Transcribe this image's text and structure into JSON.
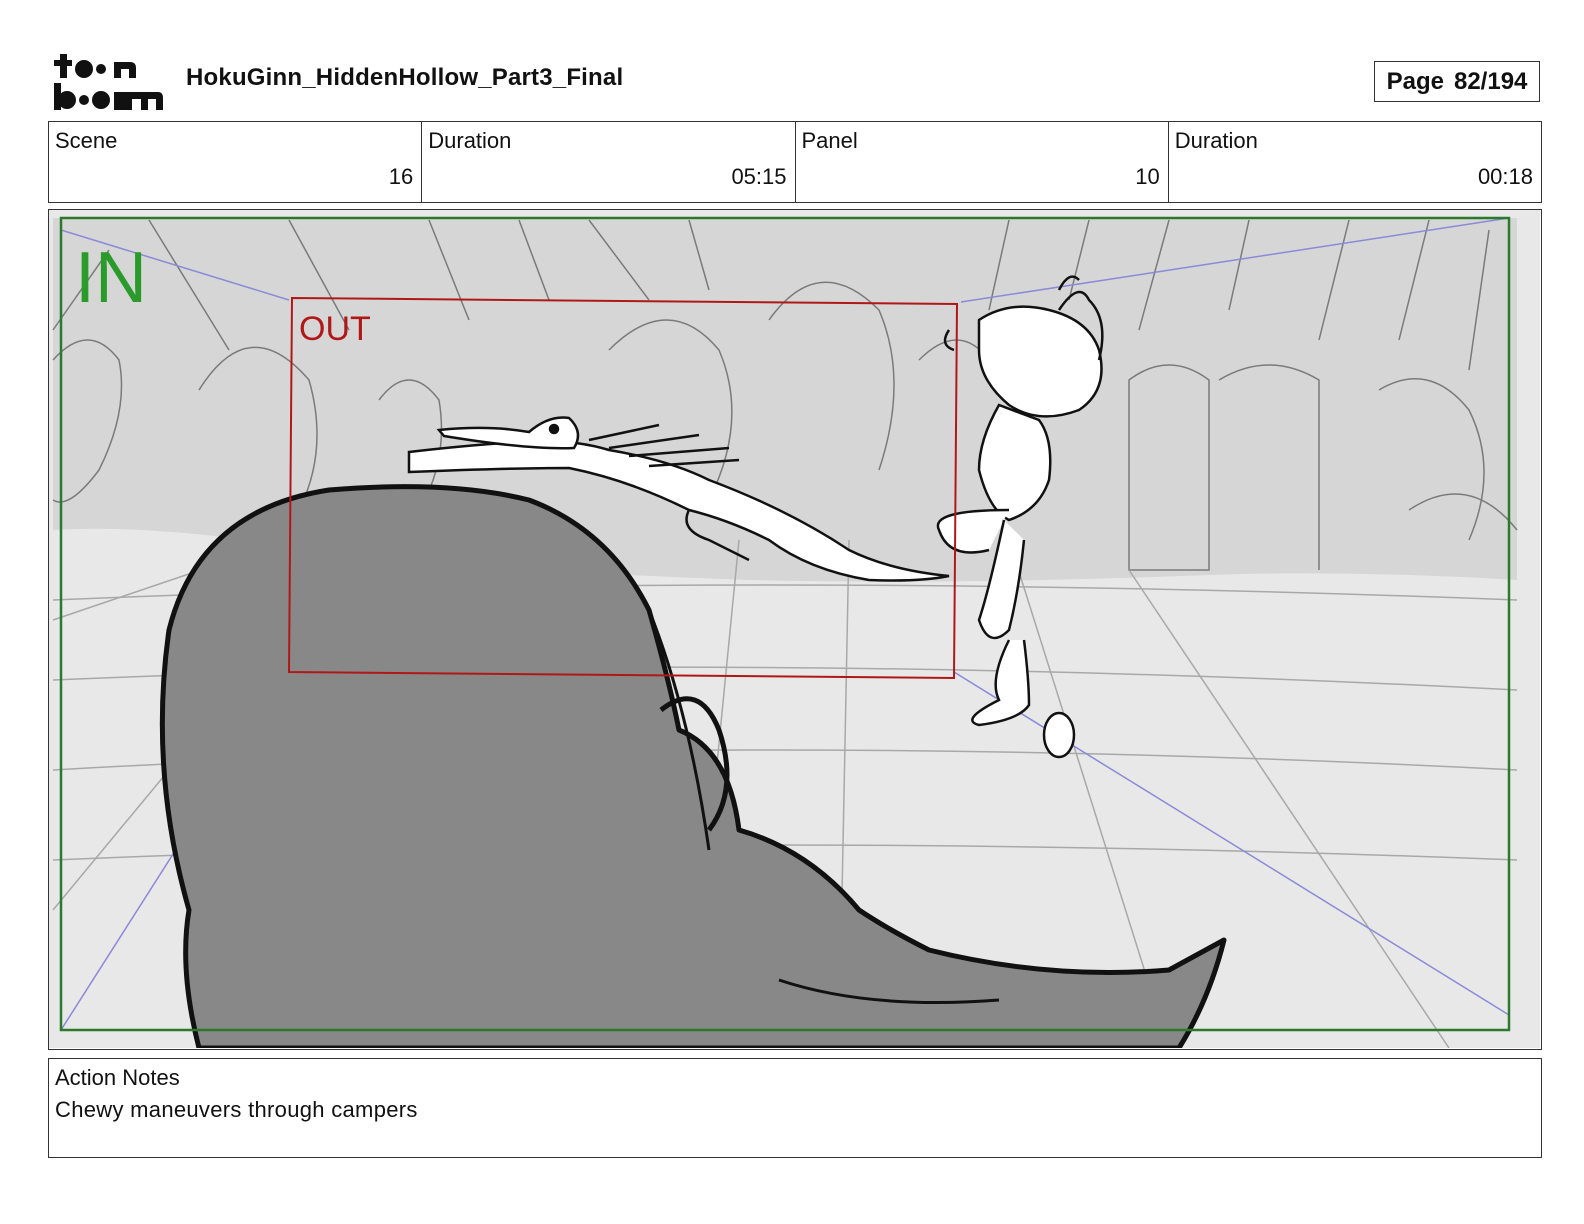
{
  "header": {
    "logo_name": "toon boom logo",
    "title": "HokuGinn_HiddenHollow_Part3_Final",
    "page_label": "Page",
    "page_value": "82/194"
  },
  "info": {
    "scene_label": "Scene",
    "scene_value": "16",
    "scene_duration_label": "Duration",
    "scene_duration_value": "05:15",
    "panel_label": "Panel",
    "panel_value": "10",
    "panel_duration_label": "Duration",
    "panel_duration_value": "00:18"
  },
  "panel": {
    "in_label": "IN",
    "out_label": "OUT",
    "in_color": "#2a9a2a",
    "out_color": "#b01818"
  },
  "notes": {
    "title": "Action Notes",
    "text": "Chewy maneuvers through campers"
  }
}
